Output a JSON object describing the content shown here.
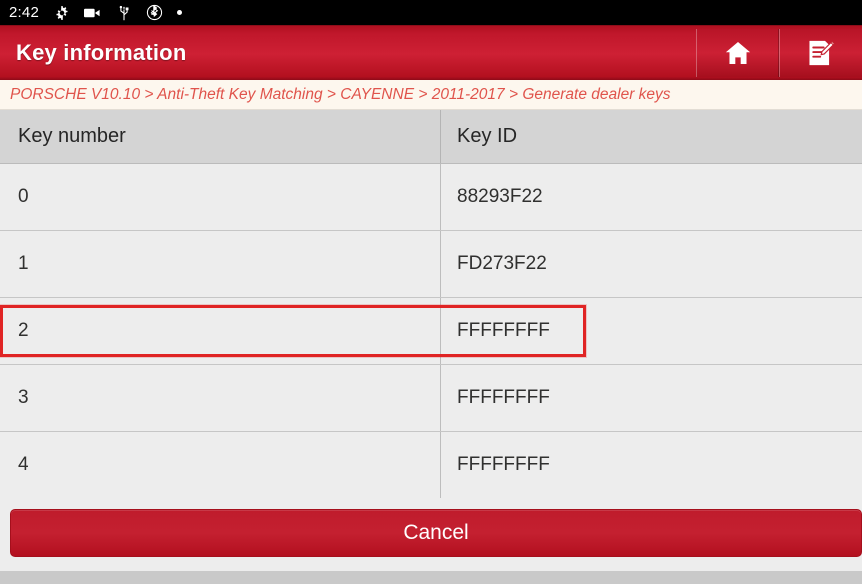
{
  "statusbar": {
    "clock": "2:42",
    "icons": [
      "gear-icon",
      "video-camera-icon",
      "usb-icon",
      "bluetooth-icon",
      "dot-icon"
    ]
  },
  "header": {
    "title": "Key information",
    "actions": [
      {
        "name": "home-button",
        "icon": "home-icon"
      },
      {
        "name": "feedback-button",
        "icon": "edit-note-icon"
      }
    ]
  },
  "breadcrumb": {
    "text": "PORSCHE V10.10 > Anti-Theft Key Matching > CAYENNE > 2011-2017 > Generate dealer keys",
    "items": [
      "PORSCHE V10.10",
      "Anti-Theft Key Matching",
      "CAYENNE",
      "2011-2017",
      "Generate dealer keys"
    ],
    "separator": ">"
  },
  "table": {
    "columns": [
      "Key number",
      "Key ID"
    ],
    "rows": [
      {
        "key_number": "0",
        "key_id": "88293F22",
        "highlighted": false
      },
      {
        "key_number": "1",
        "key_id": "FD273F22",
        "highlighted": false
      },
      {
        "key_number": "2",
        "key_id": "FFFFFFFF",
        "highlighted": true
      },
      {
        "key_number": "3",
        "key_id": "FFFFFFFF",
        "highlighted": false
      },
      {
        "key_number": "4",
        "key_id": "FFFFFFFF",
        "highlighted": false
      },
      {
        "key_number": "",
        "key_id": "",
        "highlighted": false
      }
    ]
  },
  "footer": {
    "cancel_label": "Cancel"
  },
  "colors": {
    "brand_red": "#c42030",
    "header_red": "#ce2034",
    "highlight_red": "#e02424",
    "breadcrumb_text": "#e0544c",
    "breadcrumb_bg": "#fdf7ee",
    "table_header_bg": "#d4d4d4",
    "row_bg": "#ededed",
    "statusbar_bg": "#000000"
  }
}
